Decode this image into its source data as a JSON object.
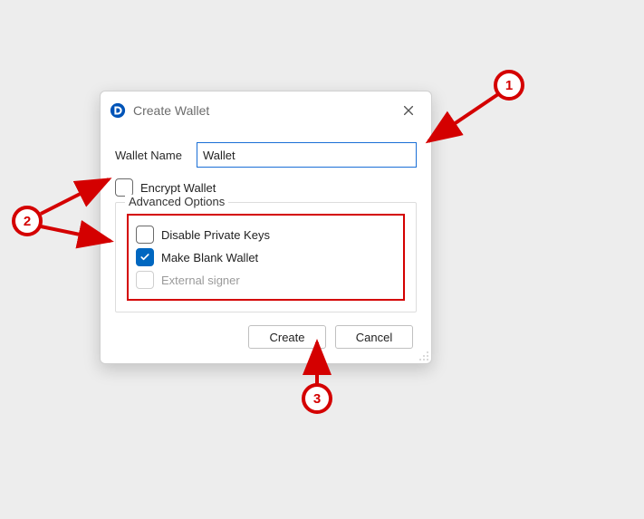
{
  "dialog": {
    "title": "Create Wallet",
    "walletName": {
      "label": "Wallet Name",
      "value": "Wallet"
    },
    "encrypt": {
      "label": "Encrypt Wallet",
      "checked": false
    },
    "advanced": {
      "legend": "Advanced Options",
      "disablePrivateKeys": {
        "label": "Disable Private Keys",
        "checked": false
      },
      "makeBlankWallet": {
        "label": "Make Blank Wallet",
        "checked": true
      },
      "externalSigner": {
        "label": "External signer",
        "checked": false,
        "disabled": true
      }
    },
    "buttons": {
      "create": "Create",
      "cancel": "Cancel"
    }
  },
  "annotations": {
    "callout1": "1",
    "callout2": "2",
    "callout3": "3",
    "color": "#d40000"
  }
}
